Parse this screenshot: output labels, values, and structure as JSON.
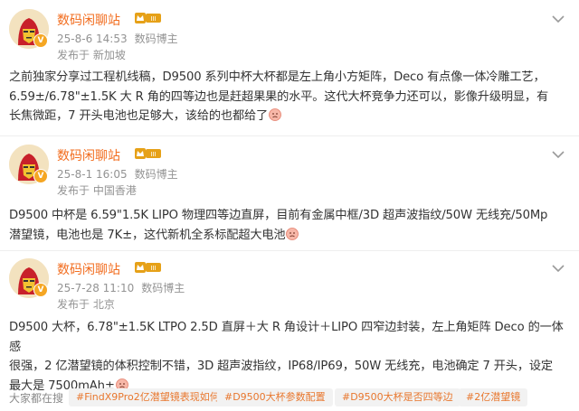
{
  "posts": [
    {
      "author": "数码闲聊站",
      "time": "25-8-6 14:53",
      "role": "数码博主",
      "source": "发布于 新加坡",
      "lines": [
        "之前独家分享过工程机线稿，D9500 系列中杯大杯都是左上角小方矩阵，Deco 有点像一体冷雕工艺，",
        "6.59±/6.78\"±1.5K 大 R 角的四等边也是赶超果果的水平。这代大杯竞争力还可以，影像升级明显，有",
        "长焦微距，7 开头电池也足够大，该给的也都给了"
      ]
    },
    {
      "author": "数码闲聊站",
      "time": "25-8-1 16:05",
      "role": "数码博主",
      "source": "发布于 中国香港",
      "lines": [
        "D9500 中杯是 6.59\"1.5K LIPO 物理四等边直屏，目前有金属中框/3D 超声波指纹/50W 无线充/50Mp",
        "潜望镜，电池也是 7K±，这代新机全系标配超大电池"
      ]
    },
    {
      "author": "数码闲聊站",
      "time": "25-7-28 11:10",
      "role": "数码博主",
      "source": "发布于 北京",
      "lines": [
        "D9500 大杯，6.78\"±1.5K LTPO 2.5D 直屏＋大 R 角设计＋LIPO 四窄边封装，左上角矩阵 Deco 的一体感",
        "很强，2 亿潜望镜的体积控制不错，3D 超声波指纹，IP68/IP69，50W 无线充，电池确定 7 开头，设定",
        "最大是 7500mAh±"
      ]
    }
  ],
  "topics": {
    "lead": "大家都在搜",
    "items": [
      "#FindX9Pro2亿潜望镜表现如何",
      "#D9500大杯参数配置",
      "#D9500大杯是否四等边",
      "#2亿潜望镜"
    ]
  },
  "colors": {
    "author": "#f26d1f",
    "topic": "#e8772e",
    "meta": "#939393"
  },
  "icons": [
    "avatar-ironman",
    "verified-badge",
    "level-badge",
    "chevron-down-icon",
    "sad-face-emoji"
  ]
}
